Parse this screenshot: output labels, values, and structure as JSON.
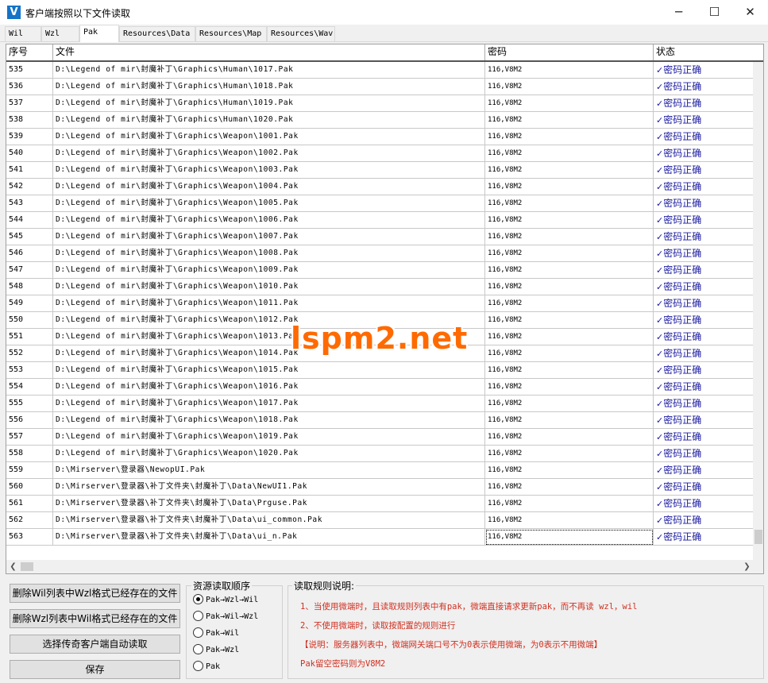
{
  "window": {
    "title": "客户端按照以下文件读取",
    "icon_letter": "V",
    "minimize": "─",
    "maximize": "☐",
    "close": "✕"
  },
  "tabs": [
    {
      "label": "Wil",
      "active": false
    },
    {
      "label": "Wzl",
      "active": false
    },
    {
      "label": "Pak",
      "active": true
    },
    {
      "label": "Resources\\Data",
      "active": false
    },
    {
      "label": "Resources\\Map",
      "active": false
    },
    {
      "label": "Resources\\Wav",
      "active": false
    }
  ],
  "table": {
    "columns": [
      "序号",
      "文件",
      "密码",
      "状态"
    ],
    "rows": [
      {
        "no": "535",
        "file": "D:\\Legend of mir\\封魔补丁\\Graphics\\Human\\1017.Pak",
        "pwd": "116,V8M2",
        "status": "密码正确"
      },
      {
        "no": "536",
        "file": "D:\\Legend of mir\\封魔补丁\\Graphics\\Human\\1018.Pak",
        "pwd": "116,V8M2",
        "status": "密码正确"
      },
      {
        "no": "537",
        "file": "D:\\Legend of mir\\封魔补丁\\Graphics\\Human\\1019.Pak",
        "pwd": "116,V8M2",
        "status": "密码正确"
      },
      {
        "no": "538",
        "file": "D:\\Legend of mir\\封魔补丁\\Graphics\\Human\\1020.Pak",
        "pwd": "116,V8M2",
        "status": "密码正确"
      },
      {
        "no": "539",
        "file": "D:\\Legend of mir\\封魔补丁\\Graphics\\Weapon\\1001.Pak",
        "pwd": "116,V8M2",
        "status": "密码正确"
      },
      {
        "no": "540",
        "file": "D:\\Legend of mir\\封魔补丁\\Graphics\\Weapon\\1002.Pak",
        "pwd": "116,V8M2",
        "status": "密码正确"
      },
      {
        "no": "541",
        "file": "D:\\Legend of mir\\封魔补丁\\Graphics\\Weapon\\1003.Pak",
        "pwd": "116,V8M2",
        "status": "密码正确"
      },
      {
        "no": "542",
        "file": "D:\\Legend of mir\\封魔补丁\\Graphics\\Weapon\\1004.Pak",
        "pwd": "116,V8M2",
        "status": "密码正确"
      },
      {
        "no": "543",
        "file": "D:\\Legend of mir\\封魔补丁\\Graphics\\Weapon\\1005.Pak",
        "pwd": "116,V8M2",
        "status": "密码正确"
      },
      {
        "no": "544",
        "file": "D:\\Legend of mir\\封魔补丁\\Graphics\\Weapon\\1006.Pak",
        "pwd": "116,V8M2",
        "status": "密码正确"
      },
      {
        "no": "545",
        "file": "D:\\Legend of mir\\封魔补丁\\Graphics\\Weapon\\1007.Pak",
        "pwd": "116,V8M2",
        "status": "密码正确"
      },
      {
        "no": "546",
        "file": "D:\\Legend of mir\\封魔补丁\\Graphics\\Weapon\\1008.Pak",
        "pwd": "116,V8M2",
        "status": "密码正确"
      },
      {
        "no": "547",
        "file": "D:\\Legend of mir\\封魔补丁\\Graphics\\Weapon\\1009.Pak",
        "pwd": "116,V8M2",
        "status": "密码正确"
      },
      {
        "no": "548",
        "file": "D:\\Legend of mir\\封魔补丁\\Graphics\\Weapon\\1010.Pak",
        "pwd": "116,V8M2",
        "status": "密码正确"
      },
      {
        "no": "549",
        "file": "D:\\Legend of mir\\封魔补丁\\Graphics\\Weapon\\1011.Pak",
        "pwd": "116,V8M2",
        "status": "密码正确"
      },
      {
        "no": "550",
        "file": "D:\\Legend of mir\\封魔补丁\\Graphics\\Weapon\\1012.Pak",
        "pwd": "116,V8M2",
        "status": "密码正确"
      },
      {
        "no": "551",
        "file": "D:\\Legend of mir\\封魔补丁\\Graphics\\Weapon\\1013.Pak",
        "pwd": "116,V8M2",
        "status": "密码正确"
      },
      {
        "no": "552",
        "file": "D:\\Legend of mir\\封魔补丁\\Graphics\\Weapon\\1014.Pak",
        "pwd": "116,V8M2",
        "status": "密码正确"
      },
      {
        "no": "553",
        "file": "D:\\Legend of mir\\封魔补丁\\Graphics\\Weapon\\1015.Pak",
        "pwd": "116,V8M2",
        "status": "密码正确"
      },
      {
        "no": "554",
        "file": "D:\\Legend of mir\\封魔补丁\\Graphics\\Weapon\\1016.Pak",
        "pwd": "116,V8M2",
        "status": "密码正确"
      },
      {
        "no": "555",
        "file": "D:\\Legend of mir\\封魔补丁\\Graphics\\Weapon\\1017.Pak",
        "pwd": "116,V8M2",
        "status": "密码正确"
      },
      {
        "no": "556",
        "file": "D:\\Legend of mir\\封魔补丁\\Graphics\\Weapon\\1018.Pak",
        "pwd": "116,V8M2",
        "status": "密码正确"
      },
      {
        "no": "557",
        "file": "D:\\Legend of mir\\封魔补丁\\Graphics\\Weapon\\1019.Pak",
        "pwd": "116,V8M2",
        "status": "密码正确"
      },
      {
        "no": "558",
        "file": "D:\\Legend of mir\\封魔补丁\\Graphics\\Weapon\\1020.Pak",
        "pwd": "116,V8M2",
        "status": "密码正确"
      },
      {
        "no": "559",
        "file": "D:\\Mirserver\\登录器\\NewopUI.Pak",
        "pwd": "116,V8M2",
        "status": "密码正确"
      },
      {
        "no": "560",
        "file": "D:\\Mirserver\\登录器\\补丁文件夹\\封魔补丁\\Data\\NewUI1.Pak",
        "pwd": "116,V8M2",
        "status": "密码正确"
      },
      {
        "no": "561",
        "file": "D:\\Mirserver\\登录器\\补丁文件夹\\封魔补丁\\Data\\Prguse.Pak",
        "pwd": "116,V8M2",
        "status": "密码正确"
      },
      {
        "no": "562",
        "file": "D:\\Mirserver\\登录器\\补丁文件夹\\封魔补丁\\Data\\ui_common.Pak",
        "pwd": "116,V8M2",
        "status": "密码正确"
      },
      {
        "no": "563",
        "file": "D:\\Mirserver\\登录器\\补丁文件夹\\封魔补丁\\Data\\ui_n.Pak",
        "pwd": "116,V8M2",
        "status": "密码正确"
      }
    ],
    "status_mark": "✓"
  },
  "watermark": "lspm2.net",
  "actions": {
    "delete_wil_label": "删除Wil列表中Wzl格式已经存在的文件",
    "delete_wzl_label": "删除Wzl列表中Wil格式已经存在的文件",
    "auto_read_label": "选择传奇客户端自动读取",
    "save_label": "保存"
  },
  "order_group": {
    "title": "资源读取顺序",
    "options": [
      {
        "label": "Pak→Wzl→Wil",
        "checked": true
      },
      {
        "label": "Pak→Wil→Wzl",
        "checked": false
      },
      {
        "label": "Pak→Wil",
        "checked": false
      },
      {
        "label": "Pak→Wzl",
        "checked": false
      },
      {
        "label": "Pak",
        "checked": false
      }
    ]
  },
  "rules_group": {
    "title": "读取规则说明:",
    "lines": [
      "1、当使用微端时，且读取规则列表中有pak，微端直接请求更新pak，而不再读 wzl，wil",
      "2、不使用微端时，读取按配置的规则进行",
      "【说明：服务器列表中，微端网关端口号不为0表示使用微端，为0表示不用微端】",
      "Pak留空密码则为V8M2"
    ]
  },
  "colors": {
    "status_text": "#1a1aa0",
    "rule_text": "#d03020",
    "watermark": "#ff6a00",
    "app_icon": "#1473c7"
  }
}
